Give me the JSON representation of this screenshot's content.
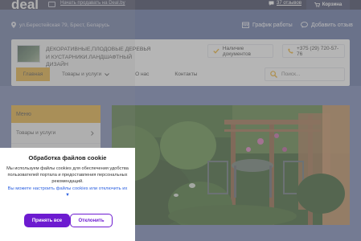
{
  "header": {
    "logo": "deal",
    "sell_link": "Начать продавать на Deal.by",
    "reviews_label": "37 отзывов",
    "cart_label": "Корзина"
  },
  "band": {
    "address": "ул.Берестейская 79, Брест, Беларусь",
    "schedule": "График работы",
    "add_review": "Добавить отзыв"
  },
  "company": {
    "name": "ДЕКОРАТИВНЫЕ,ПЛОДОВЫЕ ДЕРЕВЬЯ И КУСТАРНИКИ.ЛАНДШАФТНЫЙ ДИЗАЙН",
    "docs_label": "Наличие документов",
    "phone": "+375 (29) 720-57-76"
  },
  "nav": {
    "home": "Главная",
    "products": "Товары и услуги",
    "about": "О нас",
    "contacts": "Контакты"
  },
  "search": {
    "placeholder": "Поиск..."
  },
  "sidebar": {
    "menu_title": "Меню",
    "items": [
      {
        "label": "Товары и услуги"
      }
    ]
  },
  "cookie": {
    "title": "Обработка файлов cookie",
    "text": "Мы используем файлы cookies для обеспечения удобства пользователей портала и предоставления персональных рекомендаций.",
    "link": "Вы можете настроить файлы cookies или отключить их ▼",
    "accept": "Принять все",
    "decline": "Отклонить"
  },
  "colors": {
    "accent": "#f0ad1e",
    "brand_band": "#5a6aa0",
    "cookie_button": "#6d1bd0",
    "link": "#2a5fe0"
  }
}
